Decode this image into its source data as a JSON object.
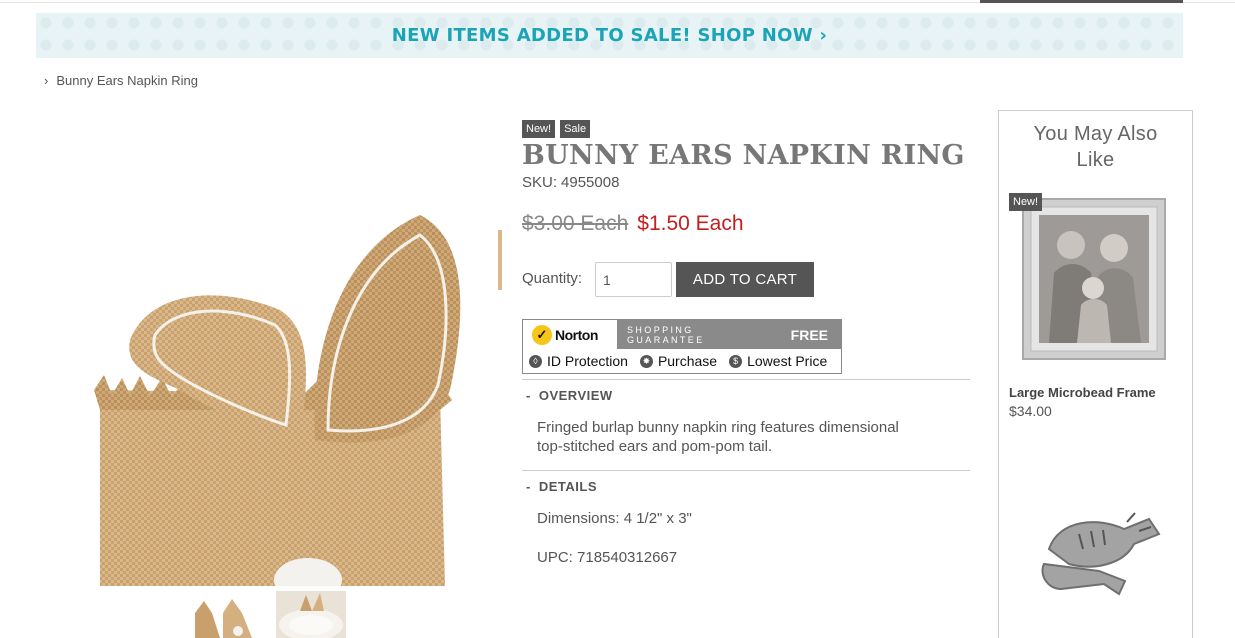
{
  "banner": {
    "text": "NEW ITEMS ADDED TO SALE! SHOP NOW ›"
  },
  "breadcrumb": {
    "separator": "›",
    "current": "Bunny Ears Napkin Ring"
  },
  "product": {
    "badges": [
      "New!",
      "Sale"
    ],
    "title": "BUNNY EARS NAPKIN RING",
    "sku_label": "SKU:",
    "sku": "4955008",
    "old_price": "$3.00 Each",
    "sale_price": "$1.50 Each",
    "quantity_label": "Quantity:",
    "quantity_value": "1",
    "add_to_cart": "ADD TO CART"
  },
  "norton": {
    "brand": "Norton",
    "check": "✓",
    "guarantee": "SHOPPING GUARANTEE",
    "free": "FREE",
    "items": [
      "ID Protection",
      "Purchase",
      "Lowest Price"
    ]
  },
  "overview": {
    "toggle": "-",
    "heading": "OVERVIEW",
    "text_line1": "Fringed burlap bunny napkin ring features dimensional",
    "text_line2": "top-stitched ears and pom-pom tail."
  },
  "details": {
    "toggle": "-",
    "heading": "DETAILS",
    "dimensions": "Dimensions: 4 1/2\" x 3\"",
    "upc": "UPC: 718540312667"
  },
  "sidebar": {
    "title_line1": "You May Also",
    "title_line2": "Like",
    "products": [
      {
        "badge": "New!",
        "name": "Large Microbead Frame",
        "price": "$34.00"
      }
    ]
  },
  "colors": {
    "banner_text": "#1ba4b8",
    "sale_price": "#c41e1e",
    "button": "#555555"
  }
}
